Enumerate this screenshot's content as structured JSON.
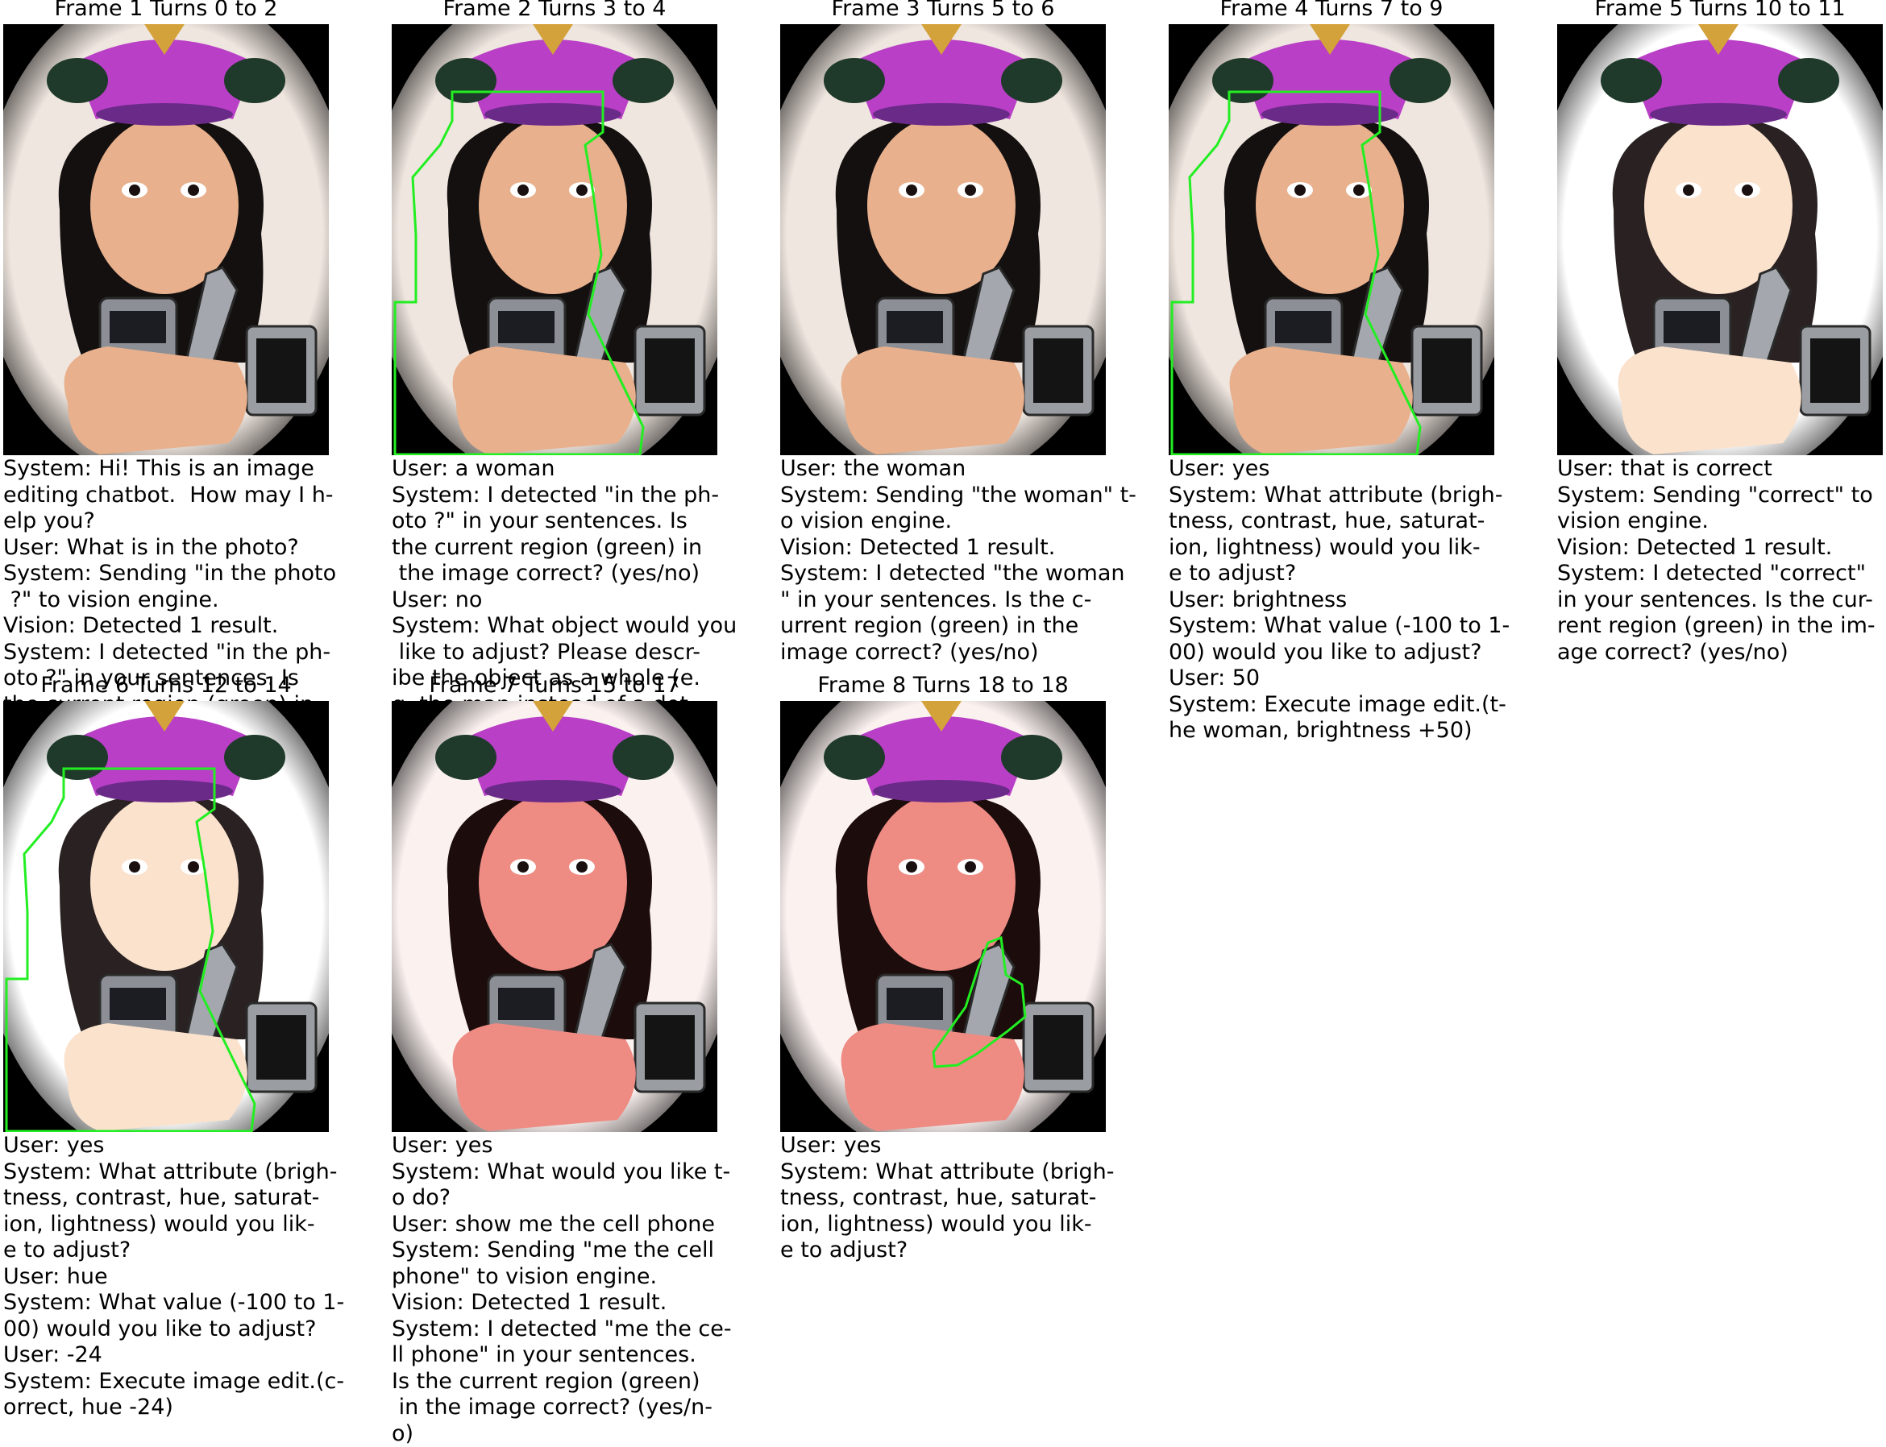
{
  "frames": [
    {
      "title": "Frame 1 Turns 0 to 2",
      "tint": "normal",
      "region": "none",
      "lines": [
        "System: Hi! This is an image",
        "editing chatbot.  How may I h-",
        "elp you?",
        "User: What is in the photo?",
        "System: Sending \"in the photo",
        " ?\" to vision engine.",
        "Vision: Detected 1 result.",
        "System: I detected \"in the ph-",
        "oto ?\" in your sentences. Is",
        "the current region (green) in"
      ]
    },
    {
      "title": "Frame 2 Turns 3 to 4",
      "tint": "normal",
      "region": "woman",
      "lines": [
        "User: a woman",
        "System: I detected \"in the ph-",
        "oto ?\" in your sentences. Is",
        "the current region (green) in",
        " the image correct? (yes/no)",
        "User: no",
        "System: What object would you",
        " like to adjust? Please descr-",
        "ibe the object as a whole (e.",
        "g. the man instead of a det"
      ]
    },
    {
      "title": "Frame 3 Turns 5 to 6",
      "tint": "normal",
      "region": "none",
      "lines": [
        "User: the woman",
        "System: Sending \"the woman\" t-",
        "o vision engine.",
        "Vision: Detected 1 result.",
        "System: I detected \"the woman",
        "\" in your sentences. Is the c-",
        "urrent region (green) in the",
        "image correct? (yes/no)"
      ]
    },
    {
      "title": "Frame 4 Turns 7 to 9",
      "tint": "normal",
      "region": "woman",
      "lines": [
        "User: yes",
        "System: What attribute (brigh-",
        "tness, contrast, hue, saturat-",
        "ion, lightness) would you lik-",
        "e to adjust?",
        "User: brightness",
        "System: What value (-100 to 1-",
        "00) would you like to adjust?",
        "User: 50",
        "System: Execute image edit.(t-",
        "he woman, brightness +50)"
      ]
    },
    {
      "title": "Frame 5 Turns 10 to 11",
      "tint": "bright",
      "region": "none",
      "lines": [
        "User: that is correct",
        "System: Sending \"correct\" to",
        "vision engine.",
        "Vision: Detected 1 result.",
        "System: I detected \"correct\"",
        "in your sentences. Is the cur-",
        "rent region (green) in the im-",
        "age correct? (yes/no)"
      ]
    },
    {
      "title": "Frame 6 Turns 12 to 14",
      "tint": "bright",
      "region": "woman",
      "lines": [
        "User: yes",
        "System: What attribute (brigh-",
        "tness, contrast, hue, saturat-",
        "ion, lightness) would you lik-",
        "e to adjust?",
        "User: hue",
        "System: What value (-100 to 1-",
        "00) would you like to adjust?",
        "User: -24",
        "System: Execute image edit.(c-",
        "orrect, hue -24)"
      ]
    },
    {
      "title": "Frame 7 Turns 15 to 17",
      "tint": "red",
      "region": "none",
      "lines": [
        "User: yes",
        "System: What would you like t-",
        "o do?",
        "User: show me the cell phone",
        "System: Sending \"me the cell",
        "phone\" to vision engine.",
        "Vision: Detected 1 result.",
        "System: I detected \"me the ce-",
        "ll phone\" in your sentences.",
        "Is the current region (green)",
        " in the image correct? (yes/n-",
        "o)"
      ]
    },
    {
      "title": "Frame 8 Turns 18 to 18",
      "tint": "red",
      "region": "phone",
      "lines": [
        "User: yes",
        "System: What attribute (brigh-",
        "tness, contrast, hue, saturat-",
        "ion, lightness) would you lik-",
        "e to adjust?"
      ]
    }
  ]
}
